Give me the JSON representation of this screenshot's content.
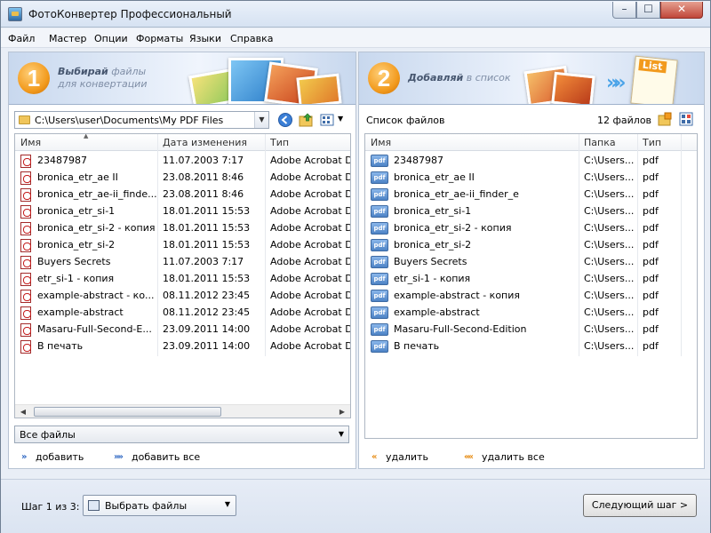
{
  "window": {
    "title": "ФотоКонвертер Профессиональный",
    "min_glyph": "–",
    "max_glyph": "☐",
    "close_glyph": "✕"
  },
  "menu": [
    "Файл",
    "Мастер",
    "Опции",
    "Форматы",
    "Языки",
    "Справка"
  ],
  "step1": {
    "number": "1",
    "line1_bold": "Выбирай",
    "line1_rest": " файлы",
    "line2": "для конвертации"
  },
  "step2": {
    "number": "2",
    "line1_bold": "Добавляй",
    "line1_rest": " в список"
  },
  "left": {
    "path": "C:\\Users\\user\\Documents\\My PDF Files",
    "columns": [
      "Имя",
      "Дата изменения",
      "Тип"
    ],
    "files": [
      {
        "name": "23487987",
        "date": "11.07.2003 7:17",
        "type": "Adobe Acrobat D"
      },
      {
        "name": "bronica_etr_ae II",
        "date": "23.08.2011 8:46",
        "type": "Adobe Acrobat D"
      },
      {
        "name": "bronica_etr_ae-ii_finde...",
        "date": "23.08.2011 8:46",
        "type": "Adobe Acrobat D"
      },
      {
        "name": "bronica_etr_si-1",
        "date": "18.01.2011 15:53",
        "type": "Adobe Acrobat D"
      },
      {
        "name": "bronica_etr_si-2 - копия",
        "date": "18.01.2011 15:53",
        "type": "Adobe Acrobat D"
      },
      {
        "name": "bronica_etr_si-2",
        "date": "18.01.2011 15:53",
        "type": "Adobe Acrobat D"
      },
      {
        "name": "Buyers Secrets",
        "date": "11.07.2003 7:17",
        "type": "Adobe Acrobat D"
      },
      {
        "name": "etr_si-1 - копия",
        "date": "18.01.2011 15:53",
        "type": "Adobe Acrobat D"
      },
      {
        "name": "example-abstract - ко...",
        "date": "08.11.2012 23:45",
        "type": "Adobe Acrobat D"
      },
      {
        "name": "example-abstract",
        "date": "08.11.2012 23:45",
        "type": "Adobe Acrobat D"
      },
      {
        "name": "Masaru-Full-Second-E...",
        "date": "23.09.2011 14:00",
        "type": "Adobe Acrobat D"
      },
      {
        "name": "В печать",
        "date": "23.09.2011 14:00",
        "type": "Adobe Acrobat D"
      }
    ],
    "filter": "Все файлы",
    "add_label": "добавить",
    "add_all_label": "добавить все"
  },
  "right": {
    "header": "Список файлов",
    "count": "12 файлов",
    "columns": [
      "Имя",
      "Папка",
      "Тип"
    ],
    "files": [
      {
        "name": "23487987",
        "folder": "C:\\Users...",
        "type": "pdf"
      },
      {
        "name": "bronica_etr_ae II",
        "folder": "C:\\Users...",
        "type": "pdf"
      },
      {
        "name": "bronica_etr_ae-ii_finder_e",
        "folder": "C:\\Users...",
        "type": "pdf"
      },
      {
        "name": "bronica_etr_si-1",
        "folder": "C:\\Users...",
        "type": "pdf"
      },
      {
        "name": "bronica_etr_si-2 - копия",
        "folder": "C:\\Users...",
        "type": "pdf"
      },
      {
        "name": "bronica_etr_si-2",
        "folder": "C:\\Users...",
        "type": "pdf"
      },
      {
        "name": "Buyers Secrets",
        "folder": "C:\\Users...",
        "type": "pdf"
      },
      {
        "name": "etr_si-1 - копия",
        "folder": "C:\\Users...",
        "type": "pdf"
      },
      {
        "name": "example-abstract - копия",
        "folder": "C:\\Users...",
        "type": "pdf"
      },
      {
        "name": "example-abstract",
        "folder": "C:\\Users...",
        "type": "pdf"
      },
      {
        "name": "Masaru-Full-Second-Edition",
        "folder": "C:\\Users...",
        "type": "pdf"
      },
      {
        "name": "В печать",
        "folder": "C:\\Users...",
        "type": "pdf"
      }
    ],
    "remove_label": "удалить",
    "remove_all_label": "удалить все",
    "list_badge": "List",
    "icon_text": "pdf"
  },
  "footer": {
    "step_label": "Шаг 1 из 3:",
    "step_select": "Выбрать файлы",
    "next_button": "Следующий шаг >"
  },
  "colors": {
    "accent": "#f29a1d",
    "title_bg": "#dbe5f2",
    "panel_border": "#b7c3d3"
  }
}
